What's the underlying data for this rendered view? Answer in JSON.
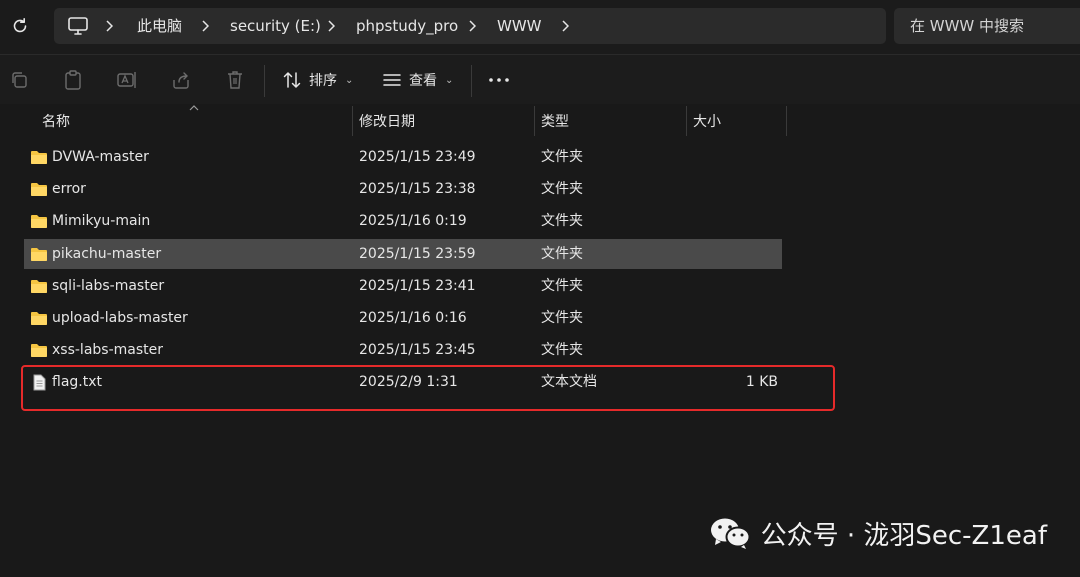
{
  "breadcrumb": {
    "items": [
      "此电脑",
      "security (E:)",
      "phpstudy_pro",
      "WWW"
    ]
  },
  "search": {
    "placeholder": "在 WWW 中搜索"
  },
  "command_bar": {
    "sort_label": "排序",
    "view_label": "查看"
  },
  "columns": {
    "name": "名称",
    "date": "修改日期",
    "type": "类型",
    "size": "大小"
  },
  "files": [
    {
      "name": "DVWA-master",
      "date": "2025/1/15 23:49",
      "type": "文件夹",
      "size": "",
      "kind": "folder"
    },
    {
      "name": "error",
      "date": "2025/1/15 23:38",
      "type": "文件夹",
      "size": "",
      "kind": "folder"
    },
    {
      "name": "Mimikyu-main",
      "date": "2025/1/16 0:19",
      "type": "文件夹",
      "size": "",
      "kind": "folder"
    },
    {
      "name": "pikachu-master",
      "date": "2025/1/15 23:59",
      "type": "文件夹",
      "size": "",
      "kind": "folder",
      "selected": true
    },
    {
      "name": "sqli-labs-master",
      "date": "2025/1/15 23:41",
      "type": "文件夹",
      "size": "",
      "kind": "folder"
    },
    {
      "name": "upload-labs-master",
      "date": "2025/1/16 0:16",
      "type": "文件夹",
      "size": "",
      "kind": "folder"
    },
    {
      "name": "xss-labs-master",
      "date": "2025/1/15 23:45",
      "type": "文件夹",
      "size": "",
      "kind": "folder"
    },
    {
      "name": "flag.txt",
      "date": "2025/2/9 1:31",
      "type": "文本文档",
      "size": "1 KB",
      "kind": "text-file"
    }
  ],
  "watermark": {
    "text": "公众号 · 泷羽Sec-Z1eaf"
  },
  "colors": {
    "background": "#191919",
    "selected_row": "#4a4a4a",
    "folder": "#f5c542",
    "highlight_box": "#e62a2a"
  },
  "icons": [
    "refresh-icon",
    "computer-icon",
    "chevron-right-icon",
    "copy-icon",
    "paste-icon",
    "rename-icon",
    "share-icon",
    "delete-icon",
    "sort-icon",
    "view-icon",
    "more-icon",
    "folder-icon",
    "text-file-icon",
    "wechat-icon"
  ]
}
